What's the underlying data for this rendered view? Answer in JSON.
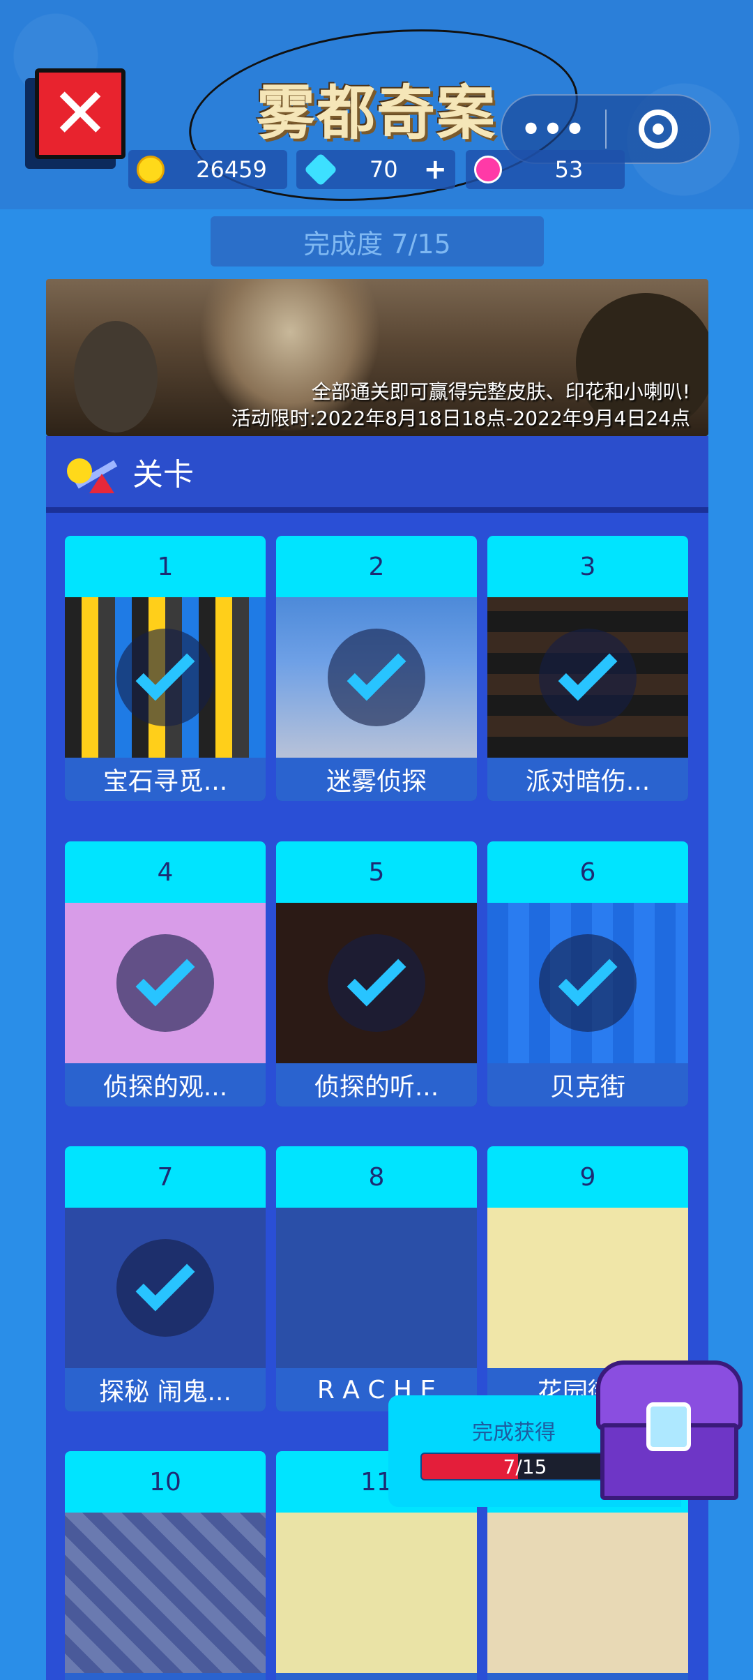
{
  "header": {
    "title": "雾都奇案",
    "close_icon": "close-icon",
    "capsule": {
      "more_label": "•••",
      "target_icon": "target-icon"
    }
  },
  "currency": {
    "coins": "26459",
    "gems": "70",
    "gems_plus": "+",
    "tokens": "53"
  },
  "progress": {
    "label": "完成度 7/15"
  },
  "banner": {
    "line1": "全部通关即可赢得完整皮肤、印花和小喇叭!",
    "line2": "活动限时:2022年8月18日18点-2022年9月4日24点"
  },
  "levels_panel": {
    "title": "关卡",
    "items": [
      {
        "num": "1",
        "label": "宝石寻觅...",
        "completed": true
      },
      {
        "num": "2",
        "label": "迷雾侦探",
        "completed": true
      },
      {
        "num": "3",
        "label": "派对暗伤...",
        "completed": true
      },
      {
        "num": "4",
        "label": "侦探的观...",
        "completed": true
      },
      {
        "num": "5",
        "label": "侦探的听...",
        "completed": true
      },
      {
        "num": "6",
        "label": "贝克街",
        "completed": true
      },
      {
        "num": "7",
        "label": "探秘 闹鬼...",
        "completed": true
      },
      {
        "num": "8",
        "label": "R A C H E",
        "completed": false
      },
      {
        "num": "9",
        "label": "花园街道",
        "completed": false
      },
      {
        "num": "10",
        "label": "",
        "completed": false
      },
      {
        "num": "11",
        "label": "",
        "completed": false
      },
      {
        "num": "",
        "label": "",
        "completed": false
      }
    ]
  },
  "reward": {
    "title": "完成获得",
    "progress_text": "7/15",
    "progress_fraction": 0.467,
    "chest_icon": "treasure-chest-icon"
  },
  "colors": {
    "background": "#2a8ee8",
    "panel": "#2a4fd6",
    "card_header": "#00e4ff",
    "check": "#28c4ff",
    "close": "#e8232e",
    "progress_fill": "#e41e3a"
  }
}
